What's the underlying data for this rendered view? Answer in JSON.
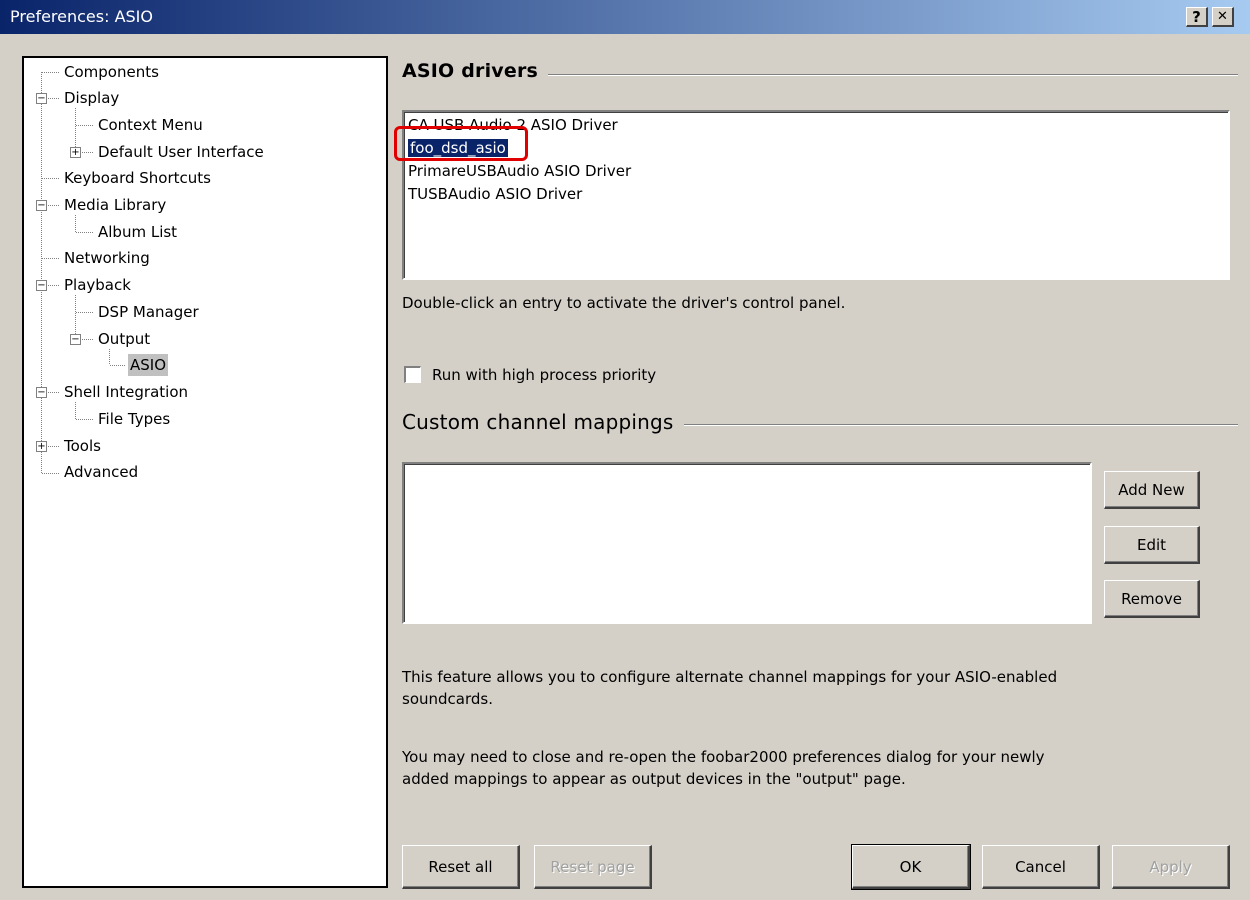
{
  "window": {
    "title": "Preferences: ASIO",
    "help_label": "?",
    "close_label": "✕"
  },
  "tree": {
    "items": [
      {
        "label": "Components"
      },
      {
        "label": "Display",
        "expander": "−"
      },
      {
        "label": "Context Menu"
      },
      {
        "label": "Default User Interface",
        "expander": "+"
      },
      {
        "label": "Keyboard Shortcuts"
      },
      {
        "label": "Media Library",
        "expander": "−"
      },
      {
        "label": "Album List"
      },
      {
        "label": "Networking"
      },
      {
        "label": "Playback",
        "expander": "−"
      },
      {
        "label": "DSP Manager"
      },
      {
        "label": "Output",
        "expander": "−"
      },
      {
        "label": "ASIO",
        "selected": true
      },
      {
        "label": "Shell Integration",
        "expander": "−"
      },
      {
        "label": "File Types"
      },
      {
        "label": "Tools",
        "expander": "+"
      },
      {
        "label": "Advanced"
      }
    ]
  },
  "asio": {
    "title": "ASIO drivers",
    "drivers": [
      "CA USB Audio 2 ASIO Driver",
      "foo_dsd_asio",
      "PrimareUSBAudio ASIO Driver",
      "TUSBAudio ASIO Driver"
    ],
    "selected_driver": "foo_dsd_asio",
    "hint": "Double-click an entry to activate the driver's control panel.",
    "priority_label": "Run with high process priority",
    "priority_checked": false
  },
  "mappings": {
    "title": "Custom channel mappings",
    "add_label": "Add New",
    "edit_label": "Edit",
    "remove_label": "Remove",
    "desc1_line1": "This feature allows you to configure alternate channel mappings for your ASIO-enabled",
    "desc1_line2": "soundcards.",
    "desc2_line1": "You may need to close and re-open the foobar2000 preferences dialog for your newly",
    "desc2_line2": "added mappings to appear as output devices in the \"output\" page."
  },
  "footer": {
    "reset_all": "Reset all",
    "reset_page": "Reset page",
    "ok": "OK",
    "cancel": "Cancel",
    "apply": "Apply"
  }
}
